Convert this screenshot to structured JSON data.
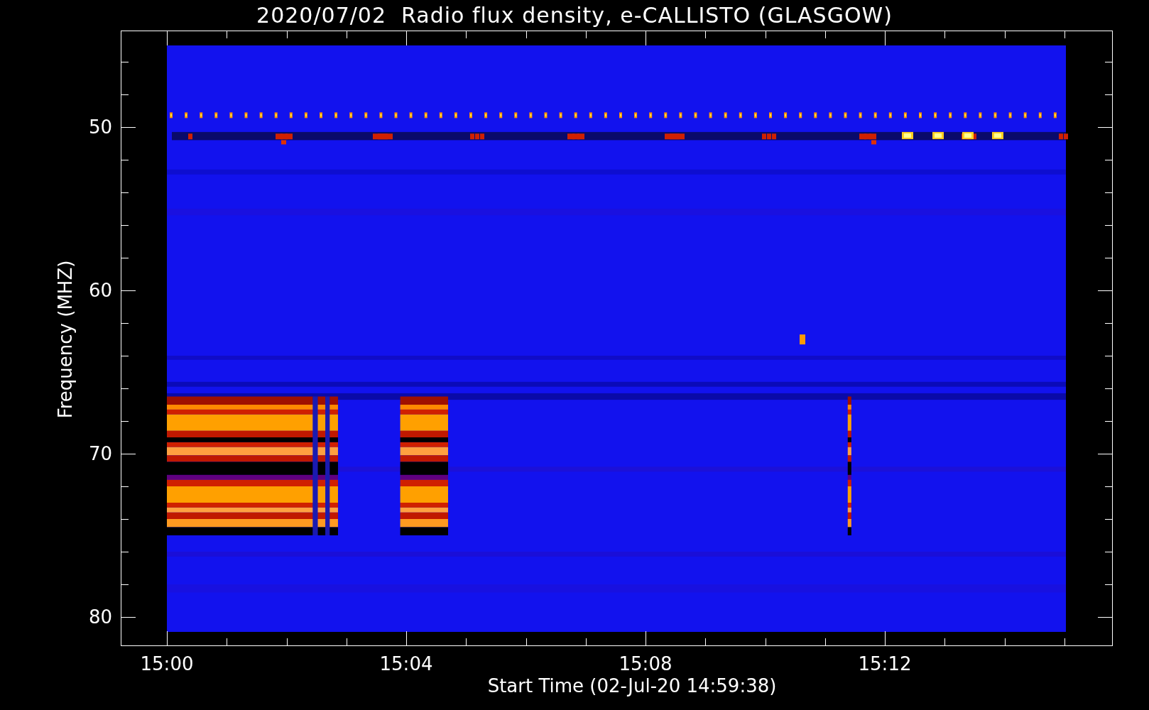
{
  "plot": {
    "title": "2020/07/02  Radio flux density, e-CALLISTO (GLASGOW)",
    "xlabel": "Start Time (02-Jul-20 14:59:38)",
    "ylabel": "Frequency (MHZ)",
    "xtick_labels": [
      "15:00",
      "15:04",
      "15:08",
      "15:12"
    ],
    "ytick_labels": [
      "50",
      "60",
      "70",
      "80"
    ]
  }
}
